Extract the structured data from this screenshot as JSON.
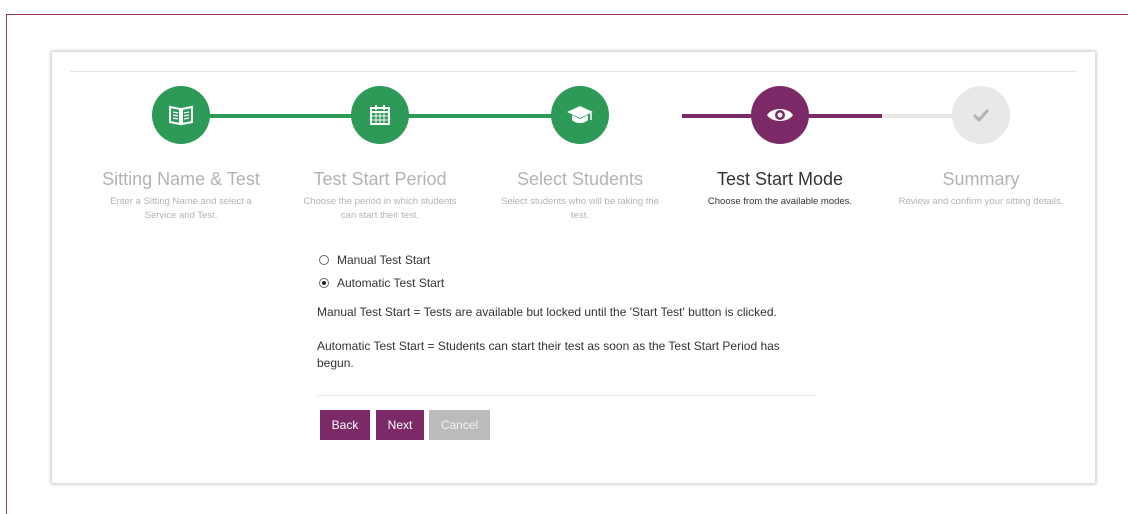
{
  "colors": {
    "complete": "#2e9a57",
    "active": "#7b2a67",
    "pending": "#e8e8e8",
    "frame": "#9b3456",
    "button": "#7b2a67",
    "button_disabled": "#bbbbbb"
  },
  "steps": [
    {
      "title": "Sitting Name & Test",
      "description": "Enter a Sitting Name and select a Service and Test.",
      "status": "complete",
      "icon": "book-icon"
    },
    {
      "title": "Test Start Period",
      "description": "Choose the period in which students can start their test.",
      "status": "complete",
      "icon": "calendar-icon"
    },
    {
      "title": "Select Students",
      "description": "Select students who will be taking the test.",
      "status": "complete",
      "icon": "graduation-cap-icon"
    },
    {
      "title": "Test Start Mode",
      "description": "Choose from the available modes.",
      "status": "active",
      "icon": "eye-icon"
    },
    {
      "title": "Summary",
      "description": "Review and confirm your sitting details.",
      "status": "pending",
      "icon": "checkmark-icon"
    }
  ],
  "options": {
    "manual_label": "Manual Test Start",
    "automatic_label": "Automatic Test Start",
    "selected": "Automatic Test Start"
  },
  "explanations": {
    "manual": "Manual Test Start = Tests are available but locked until the 'Start Test' button is clicked.",
    "automatic": "Automatic Test Start = Students can start their test as soon as the Test Start Period has begun."
  },
  "buttons": {
    "back": "Back",
    "next": "Next",
    "cancel": "Cancel"
  }
}
